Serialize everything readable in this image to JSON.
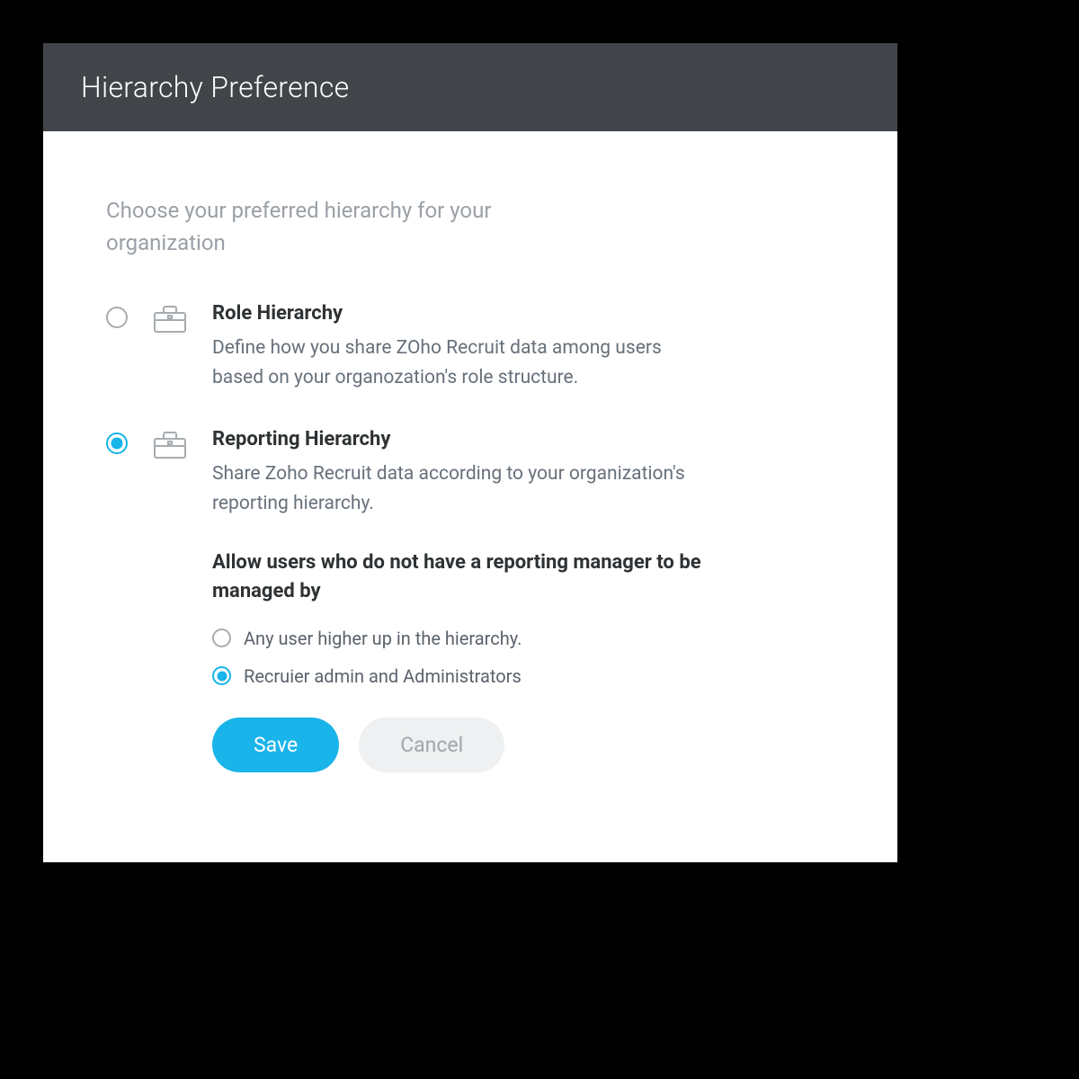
{
  "dialog": {
    "title": "Hierarchy Preference",
    "intro": "Choose your preferred hierarchy for your organization",
    "options": [
      {
        "id": "role",
        "title": "Role Hierarchy",
        "desc": "Define how you share ZOho Recruit data among users based on your organozation's role structure.",
        "selected": false
      },
      {
        "id": "reporting",
        "title": "Reporting Hierarchy",
        "desc": "Share Zoho Recruit data according to your organization's reporting hierarchy.",
        "selected": true,
        "subheading": "Allow users who do not have a reporting manager to be managed by",
        "sub_options": [
          {
            "label": "Any user higher up in the hierarchy.",
            "selected": false
          },
          {
            "label": "Recruier admin and Administrators",
            "selected": true
          }
        ]
      }
    ],
    "buttons": {
      "save": "Save",
      "cancel": "Cancel"
    }
  },
  "colors": {
    "accent": "#19b4ea",
    "header_bg": "#414549"
  }
}
